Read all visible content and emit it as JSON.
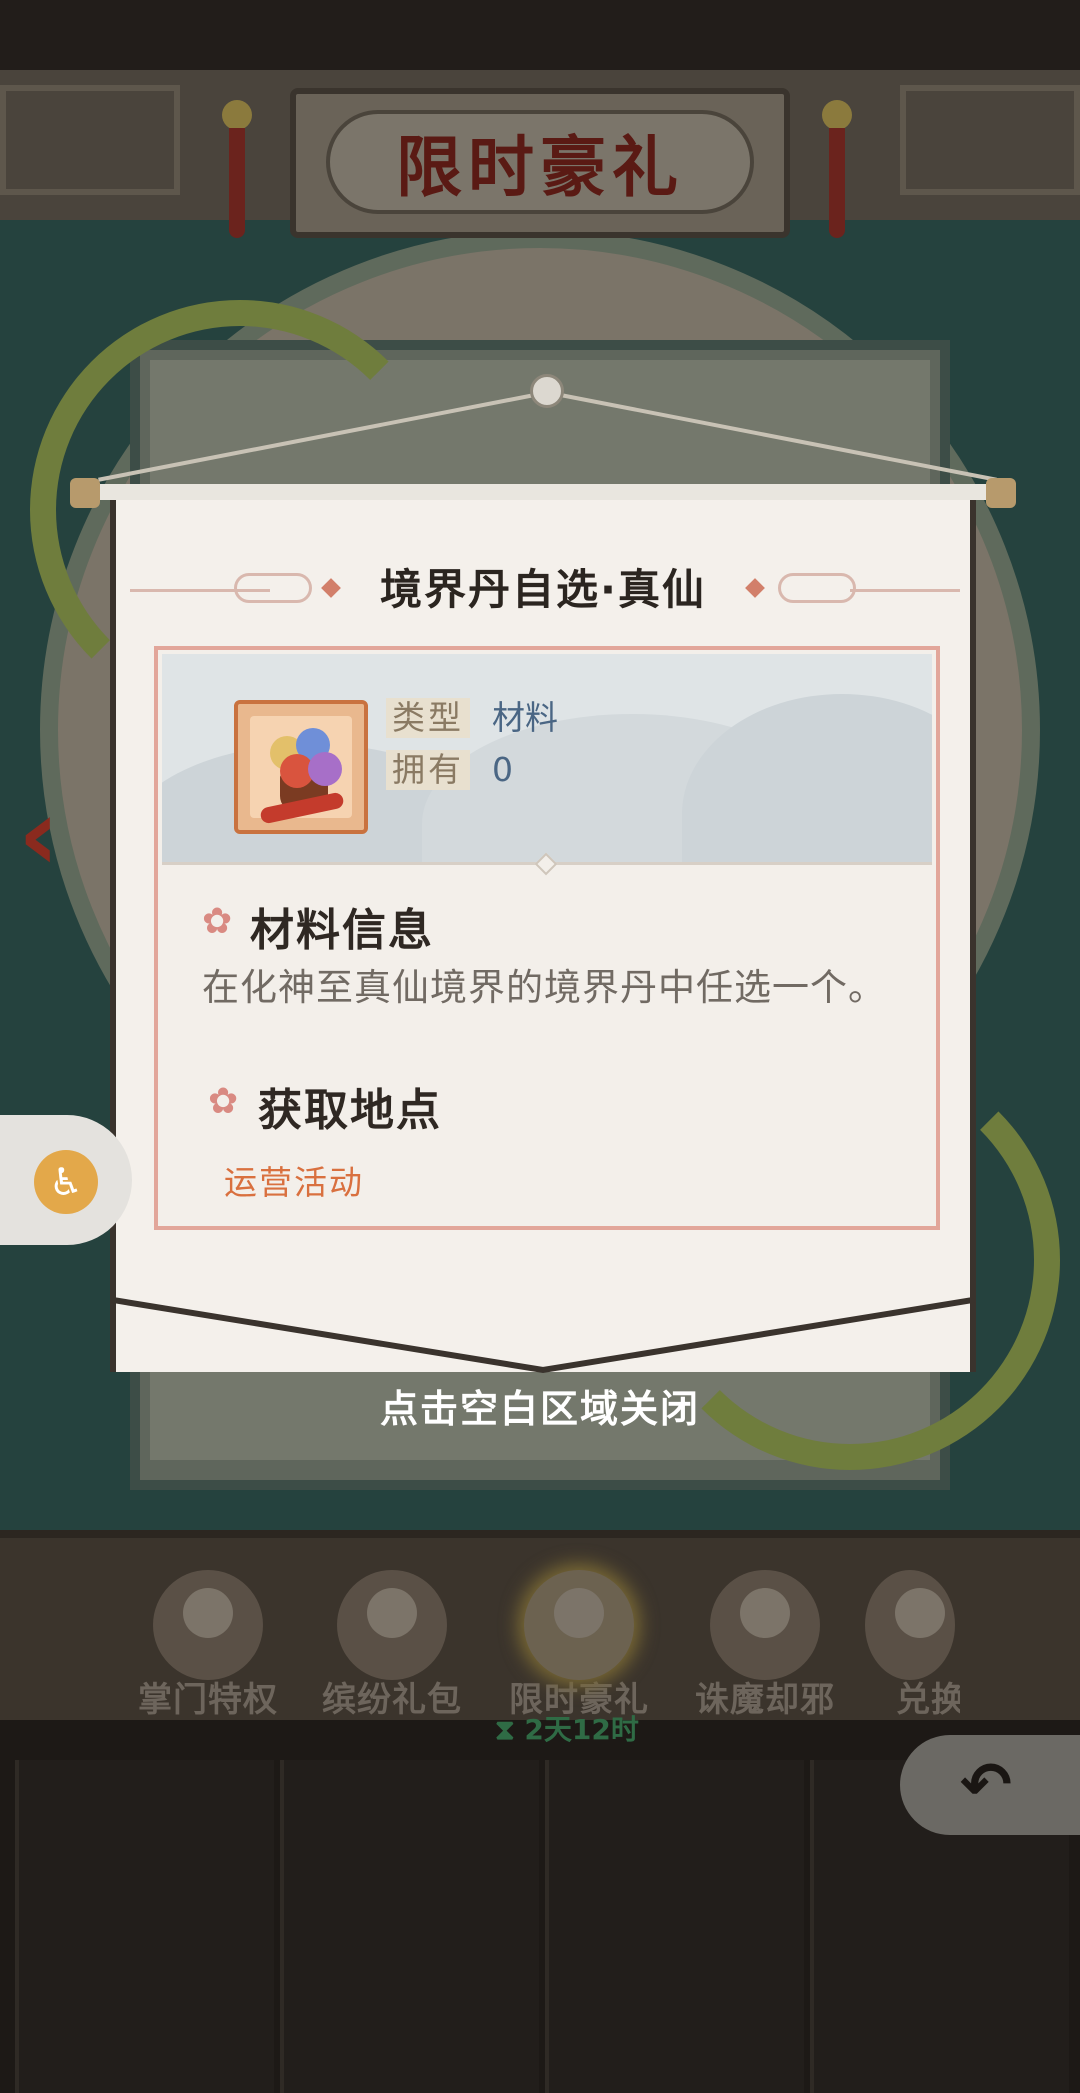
{
  "banner": {
    "title": "限时豪礼"
  },
  "popup": {
    "title": "境界丹自选·真仙",
    "item": {
      "icon": "pill-bundle-icon",
      "type_label": "类型",
      "type_value": "材料",
      "owned_label": "拥有",
      "owned_value": "0"
    },
    "info_section": {
      "title": "材料信息",
      "description": "在化神至真仙境界的境界丹中任选一个。"
    },
    "source_section": {
      "title": "获取地点",
      "link": "运营活动"
    },
    "close_hint": "点击空白区域关闭"
  },
  "bottom_tabs": [
    {
      "label": "掌门特权",
      "active": false
    },
    {
      "label": "缤纷礼包",
      "active": false
    },
    {
      "label": "限时豪礼",
      "active": true,
      "timer": "2天12时"
    },
    {
      "label": "诛魔却邪",
      "active": false
    },
    {
      "label": "兑换",
      "active": false
    }
  ],
  "icons": {
    "accessibility": "accessibility-icon",
    "back": "back-arrow-icon",
    "prev": "chevron-left-icon",
    "flower": "flower-icon",
    "hourglass": "hourglass-icon"
  },
  "colors": {
    "popup_bg": "#f4f0eb",
    "card_border": "#e2a69a",
    "accent_orange": "#d9703f",
    "value_blue": "#4a6684"
  }
}
